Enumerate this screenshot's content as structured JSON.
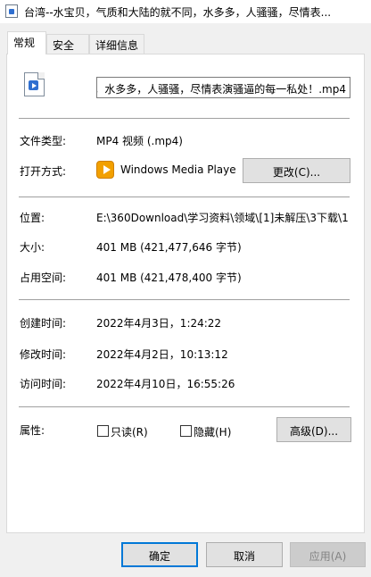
{
  "window": {
    "title": "台湾--水宝贝，气质和大陆的就不同，水多多，人骚骚，尽情表..."
  },
  "tabs": [
    {
      "label": "常规"
    },
    {
      "label": "安全"
    },
    {
      "label": "详细信息"
    }
  ],
  "general": {
    "file_name": "，水多多，人骚骚，尽情表演骚逼的每一私处！.mp4",
    "file_type_label": "文件类型:",
    "file_type_value": "MP4 视频 (.mp4)",
    "opens_with_label": "打开方式:",
    "opens_with_value": "Windows Media Playe",
    "change_button": "更改(C)...",
    "location_label": "位置:",
    "location_value": "E:\\360Download\\学习资料\\领域\\[1]未解压\\3下载\\1",
    "size_label": "大小:",
    "size_value": "401 MB (421,477,646 字节)",
    "size_on_disk_label": "占用空间:",
    "size_on_disk_value": "401 MB (421,478,400 字节)",
    "created_label": "创建时间:",
    "created_value": "2022年4月3日，1:24:22",
    "modified_label": "修改时间:",
    "modified_value": "2022年4月2日，10:13:12",
    "accessed_label": "访问时间:",
    "accessed_value": "2022年4月10日，16:55:26",
    "attributes_label": "属性:",
    "readonly_label": "只读(R)",
    "readonly_checked": false,
    "hidden_label": "隐藏(H)",
    "hidden_checked": false,
    "advanced_button": "高级(D)..."
  },
  "footer": {
    "ok_button": "确定",
    "cancel_button": "取消",
    "apply_button": "应用(A)"
  },
  "colors": {
    "default_button_border": "#0078d7",
    "panel_bg": "#ffffff",
    "window_bg": "#f0f0f0"
  }
}
